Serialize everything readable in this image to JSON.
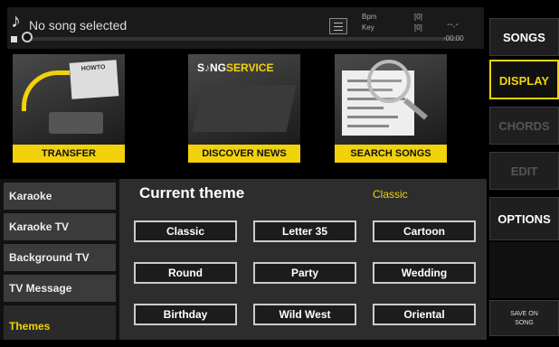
{
  "topbar": {
    "song_title": "No song selected",
    "bpm_label": "Bpm",
    "bpm_value": "[0]",
    "key_label": "Key",
    "key_value": "[0]",
    "time_dash": "--.-",
    "time_value": "-00:00"
  },
  "banners": [
    {
      "caption": "TRANSFER",
      "art_text": "HOWTO"
    },
    {
      "caption": "DISCOVER NEWS",
      "art_text_a": "S",
      "art_text_b": "NG",
      "art_text_c": "SERVICE"
    },
    {
      "caption": "SEARCH SONGS"
    }
  ],
  "right_menu": {
    "songs": "SONGS",
    "display": "DISPLAY",
    "chords": "CHORDS",
    "edit": "EDIT",
    "options": "OPTIONS",
    "save_on_song_line1": "SAVE ON",
    "save_on_song_line2": "SONG"
  },
  "left_menu": {
    "items": [
      "Karaoke",
      "Karaoke TV",
      "Background TV",
      "TV Message",
      "Themes"
    ]
  },
  "content": {
    "title": "Current theme",
    "current_value": "Classic",
    "themes": [
      "Classic",
      "Letter 35",
      "Cartoon",
      "Round",
      "Party",
      "Wedding",
      "Birthday",
      "Wild West",
      "Oriental"
    ]
  },
  "colors": {
    "accent": "#f1d20b",
    "disabled": "#555555"
  }
}
